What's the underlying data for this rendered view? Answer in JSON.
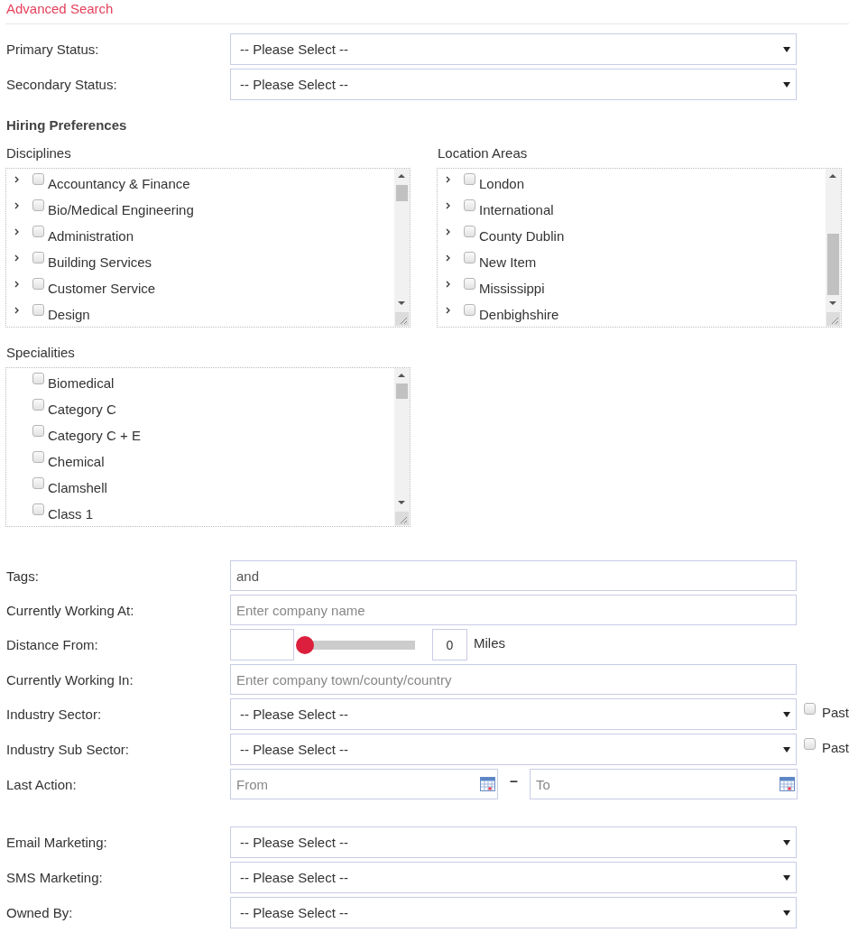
{
  "title": "Advanced Search",
  "status_fields": [
    {
      "label": "Primary Status:",
      "value": "-- Please Select --"
    },
    {
      "label": "Secondary Status:",
      "value": "-- Please Select --"
    }
  ],
  "hiring_preferences": {
    "heading": "Hiring Preferences",
    "disciplines": {
      "label": "Disciplines",
      "items": [
        {
          "label": "Accountancy & Finance",
          "expanded": false,
          "checked": false
        },
        {
          "label": "Bio/Medical Engineering",
          "expanded": false,
          "checked": false
        },
        {
          "label": "Administration",
          "expanded": false,
          "checked": false
        },
        {
          "label": "Building Services",
          "expanded": false,
          "checked": false
        },
        {
          "label": "Customer Service",
          "expanded": false,
          "checked": false
        },
        {
          "label": "Design",
          "expanded": false,
          "checked": false
        }
      ]
    },
    "location_areas": {
      "label": "Location Areas",
      "items": [
        {
          "label": "London",
          "expanded": false,
          "checked": false
        },
        {
          "label": "International",
          "expanded": false,
          "checked": false
        },
        {
          "label": "County Dublin",
          "expanded": false,
          "checked": false
        },
        {
          "label": "New Item",
          "expanded": false,
          "checked": false
        },
        {
          "label": "Mississippi",
          "expanded": false,
          "checked": false
        },
        {
          "label": "Denbighshire",
          "expanded": false,
          "checked": false
        }
      ]
    },
    "specialities": {
      "label": "Specialities",
      "items": [
        {
          "label": "Biomedical",
          "checked": false
        },
        {
          "label": "Category C",
          "checked": false
        },
        {
          "label": "Category C + E",
          "checked": false
        },
        {
          "label": "Chemical",
          "checked": false
        },
        {
          "label": "Clamshell",
          "checked": false
        },
        {
          "label": "Class 1",
          "checked": false
        }
      ]
    }
  },
  "filters": [
    {
      "kind": "text",
      "label": "Tags:",
      "value": "and"
    },
    {
      "kind": "text",
      "label": "Currently Working At:",
      "placeholder": "Enter company name"
    },
    {
      "kind": "distance",
      "label": "Distance From:",
      "level": 0,
      "reading": "0",
      "unit": "Miles"
    },
    {
      "kind": "text",
      "label": "Currently Working In:",
      "placeholder": "Enter company town/county/country"
    },
    {
      "kind": "select",
      "label": "Industry Sector:",
      "value": "-- Please Select --",
      "past": {
        "label": "Past",
        "checked": false
      }
    },
    {
      "kind": "select",
      "label": "Industry Sub Sector:",
      "value": "-- Please Select --",
      "past": {
        "label": "Past",
        "checked": false
      }
    },
    {
      "kind": "date_range",
      "label": "Last Action:",
      "from_placeholder": "From",
      "separator": "–",
      "to_placeholder": "To"
    }
  ],
  "marketing": [
    {
      "kind": "select",
      "label": "Email Marketing:",
      "value": "-- Please Select --"
    },
    {
      "kind": "select",
      "label": "SMS Marketing:",
      "value": "-- Please Select --"
    },
    {
      "kind": "select",
      "label": "Owned By:",
      "value": "-- Please Select --"
    }
  ]
}
